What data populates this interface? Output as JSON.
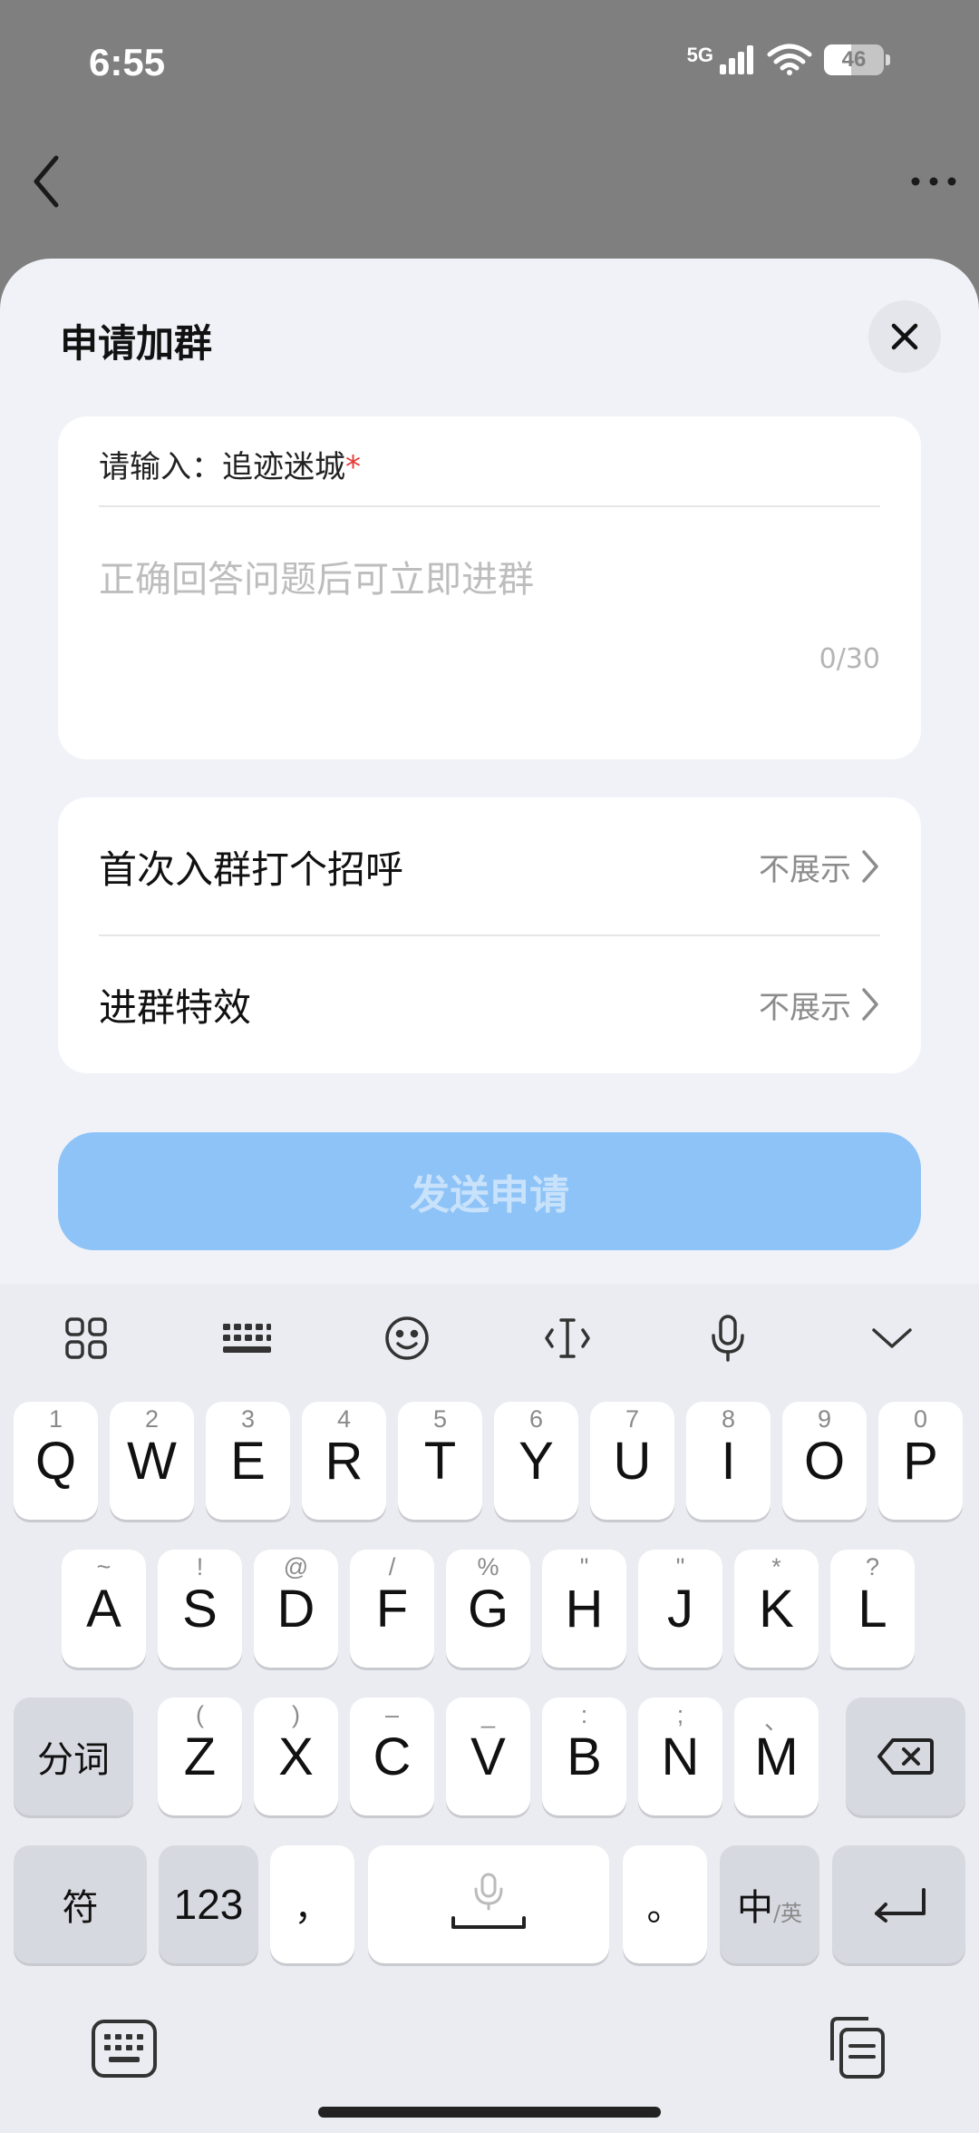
{
  "status_bar": {
    "time": "6:55",
    "network": "5G",
    "battery": "46",
    "battery_level": 0.46
  },
  "nav": {
    "back_icon": "chevron-left-icon",
    "more_icon": "more-horizontal-icon"
  },
  "sheet": {
    "title": "申请加群",
    "close_icon": "close-icon",
    "question": {
      "label": "请输入：追迹迷城",
      "required_mark": "*",
      "placeholder": "正确回答问题后可立即进群",
      "value": "",
      "counter": "0/30"
    },
    "options": [
      {
        "label": "首次入群打个招呼",
        "value": "不展示"
      },
      {
        "label": "进群特效",
        "value": "不展示"
      }
    ],
    "submit_label": "发送申请",
    "colors": {
      "submit_bg": "#8ec3f7",
      "required": "#e53935"
    }
  },
  "keyboard": {
    "toolbar_icons": [
      "apps-grid-icon",
      "keyboard-layout-icon",
      "emoji-icon",
      "text-cursor-icon",
      "microphone-icon",
      "collapse-chevron-icon"
    ],
    "row1": [
      {
        "main": "Q",
        "sub": "1"
      },
      {
        "main": "W",
        "sub": "2"
      },
      {
        "main": "E",
        "sub": "3"
      },
      {
        "main": "R",
        "sub": "4"
      },
      {
        "main": "T",
        "sub": "5"
      },
      {
        "main": "Y",
        "sub": "6"
      },
      {
        "main": "U",
        "sub": "7"
      },
      {
        "main": "I",
        "sub": "8"
      },
      {
        "main": "O",
        "sub": "9"
      },
      {
        "main": "P",
        "sub": "0"
      }
    ],
    "row2": [
      {
        "main": "A",
        "sub": "~"
      },
      {
        "main": "S",
        "sub": "!"
      },
      {
        "main": "D",
        "sub": "@"
      },
      {
        "main": "F",
        "sub": "/"
      },
      {
        "main": "G",
        "sub": "%"
      },
      {
        "main": "H",
        "sub": "\""
      },
      {
        "main": "J",
        "sub": "\""
      },
      {
        "main": "K",
        "sub": "*"
      },
      {
        "main": "L",
        "sub": "?"
      }
    ],
    "row3": [
      {
        "main": "Z",
        "sub": "("
      },
      {
        "main": "X",
        "sub": ")"
      },
      {
        "main": "C",
        "sub": "–"
      },
      {
        "main": "V",
        "sub": "_"
      },
      {
        "main": "B",
        "sub": ":"
      },
      {
        "main": "N",
        "sub": ";"
      },
      {
        "main": "M",
        "sub": "、"
      }
    ],
    "segment_key": "分词",
    "symbol_key": "符",
    "number_key": "123",
    "comma_key": "，",
    "period_key": "。",
    "lang_key_main": "中",
    "lang_key_sub": "/英",
    "backspace_icon": "backspace-icon",
    "enter_icon": "enter-icon",
    "space_icon": "space-mic-icon",
    "bottom_left_icon": "keyboard-switch-icon",
    "bottom_right_icon": "clipboard-icon"
  }
}
